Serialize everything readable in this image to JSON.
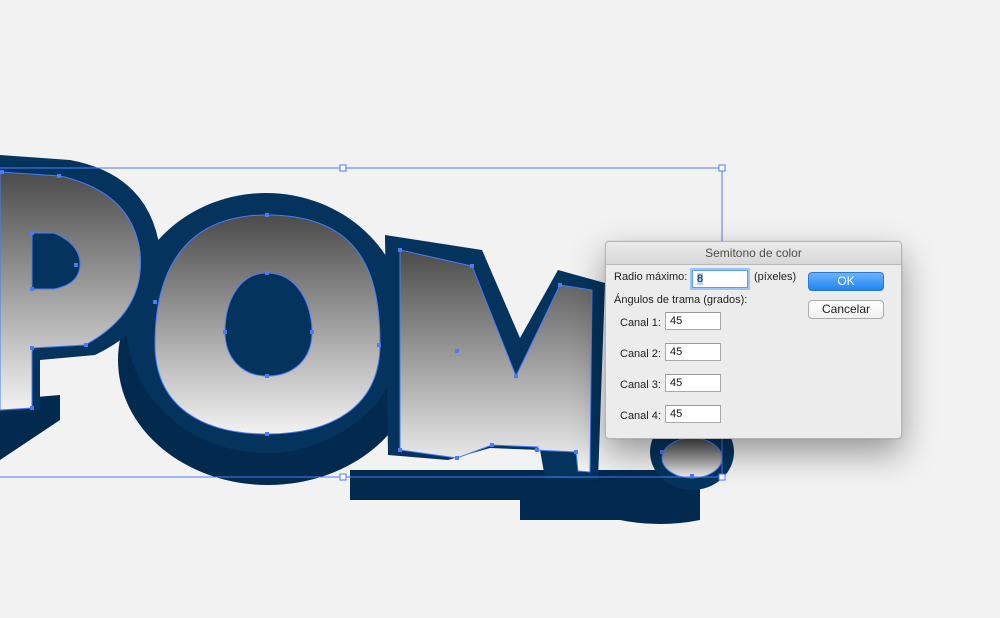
{
  "artwork": {
    "text": "POM!",
    "fill_top_color": "#4b4b4b",
    "fill_bottom_color": "#f2f2f2",
    "outline_color": "#04345e",
    "extrusion_color": "#022a4f",
    "selection_color": "#4a7cf6"
  },
  "dialog": {
    "title": "Semitono de color",
    "max_radius_label": "Radio máximo:",
    "max_radius_value": "8",
    "max_radius_unit": "(píxeles)",
    "screen_angles_label": "Ángulos de trama (grados):",
    "channels": [
      {
        "label": "Canal 1:",
        "value": "45"
      },
      {
        "label": "Canal 2:",
        "value": "45"
      },
      {
        "label": "Canal 3:",
        "value": "45"
      },
      {
        "label": "Canal 4:",
        "value": "45"
      }
    ],
    "ok_label": "OK",
    "cancel_label": "Cancelar"
  }
}
